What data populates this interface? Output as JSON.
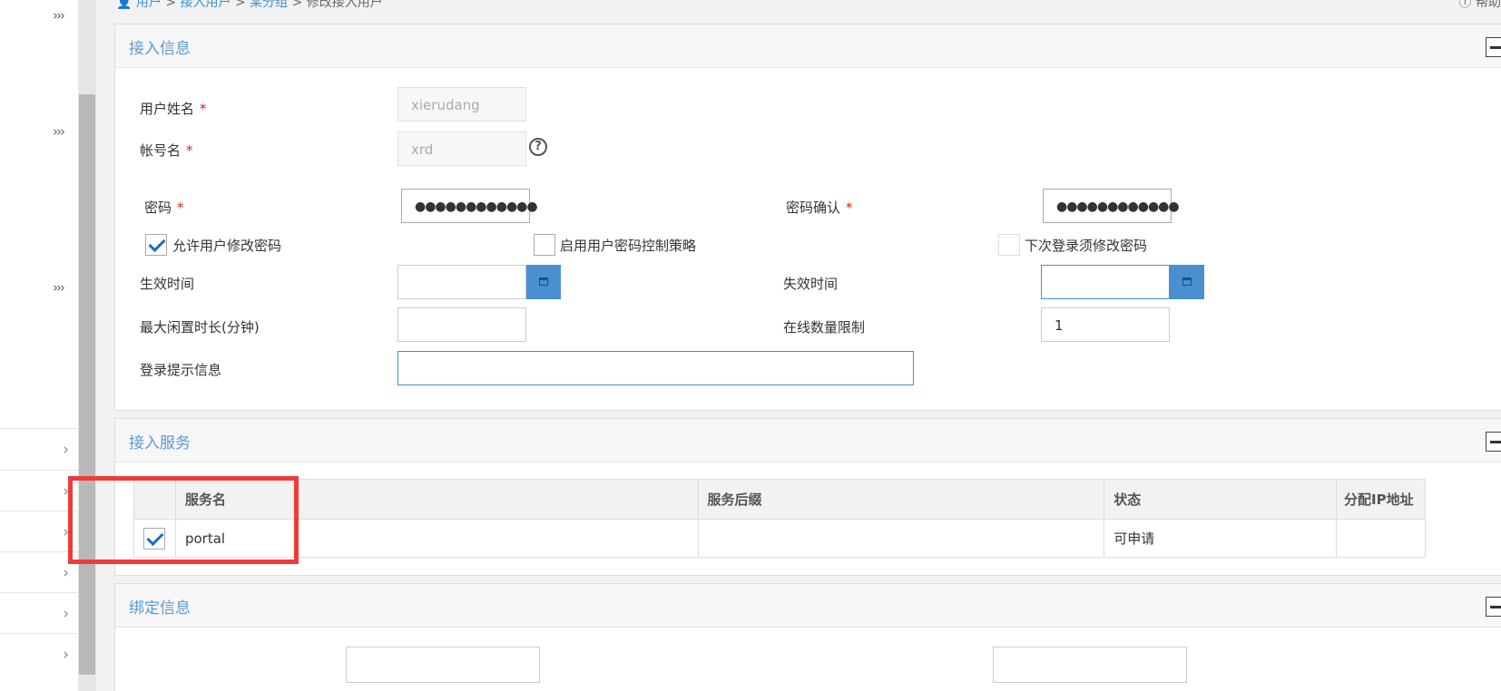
{
  "sidebar": {
    "expand_glyph": "›››",
    "chevron": "›"
  },
  "breadcrumb": {
    "home": "用户",
    "sep": ">",
    "access_users": "接入用户",
    "group": "某分组",
    "current": "修改接入用户"
  },
  "help_label": "ⓘ 帮助",
  "access_info": {
    "title": "接入信息",
    "username_label": "用户姓名",
    "username_value": "xierudang",
    "account_label": "帐号名",
    "account_value": "xrd",
    "password_label": "密码",
    "password_value": "●●●●●●●●●●●●",
    "password_confirm_label": "密码确认",
    "password_confirm_value": "●●●●●●●●●●●●",
    "allow_change_pwd": "允许用户修改密码",
    "enable_pwd_policy": "启用用户密码控制策略",
    "must_change_next": "下次登录须修改密码",
    "effective_time_label": "生效时间",
    "effective_time_value": "",
    "expire_time_label": "失效时间",
    "expire_time_value": "",
    "max_idle_label": "最大闲置时长(分钟)",
    "max_idle_value": "",
    "online_limit_label": "在线数量限制",
    "online_limit_value": "1",
    "login_hint_label": "登录提示信息",
    "login_hint_value": "",
    "required_mark": "*",
    "help_glyph": "?"
  },
  "access_service": {
    "title": "接入服务",
    "columns": [
      "",
      "服务名",
      "服务后缀",
      "状态",
      "分配IP地址"
    ],
    "rows": [
      {
        "checked": true,
        "name": "portal",
        "suffix": "",
        "status": "可申请",
        "ip": ""
      }
    ]
  },
  "binding_info": {
    "title": "绑定信息"
  },
  "colors": {
    "accent": "#4a8fd0",
    "title_blue": "#5a9bd5",
    "highlight": "#f03a3a",
    "required": "#d22222"
  }
}
